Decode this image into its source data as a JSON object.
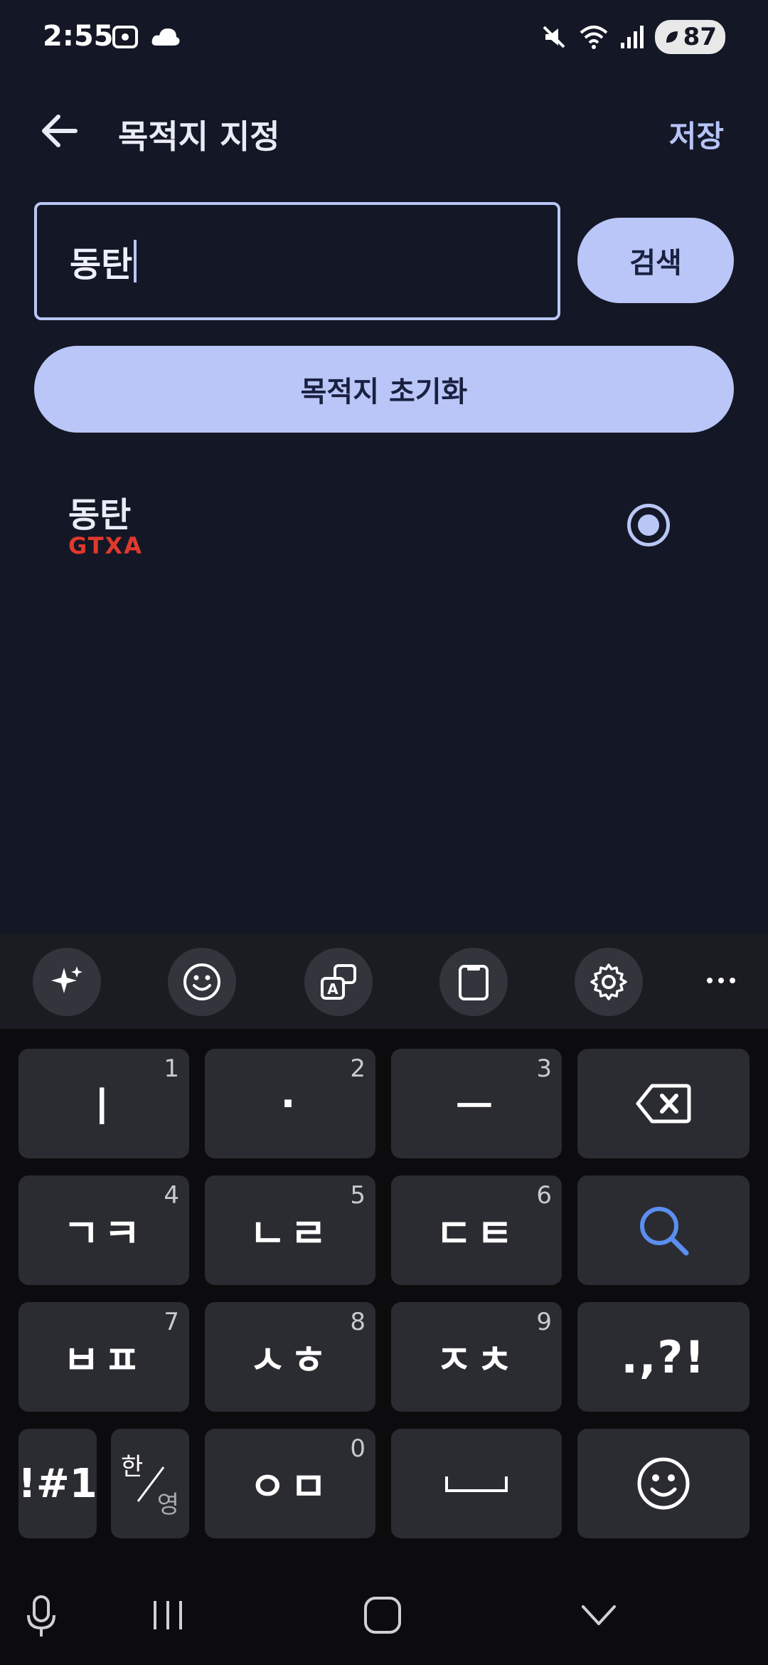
{
  "status": {
    "time": "2:55",
    "battery": "87"
  },
  "header": {
    "title": "목적지 지정",
    "save_label": "저장"
  },
  "search": {
    "value": "동탄",
    "button_label": "검색"
  },
  "reset_label": "목적지 초기화",
  "results": [
    {
      "name": "동탄",
      "line": "GTXA",
      "selected": true
    }
  ],
  "keyboard": {
    "rows": [
      [
        {
          "main": "ㅣ",
          "num": "1"
        },
        {
          "main": "·",
          "num": "2"
        },
        {
          "main": "ㅡ",
          "num": "3"
        },
        {
          "icon": "backspace-icon"
        }
      ],
      [
        {
          "main": "ㄱㅋ",
          "num": "4"
        },
        {
          "main": "ㄴㄹ",
          "num": "5"
        },
        {
          "main": "ㄷㅌ",
          "num": "6"
        },
        {
          "icon": "search-icon"
        }
      ],
      [
        {
          "main": "ㅂㅍ",
          "num": "7"
        },
        {
          "main": "ㅅㅎ",
          "num": "8"
        },
        {
          "main": "ㅈㅊ",
          "num": "9"
        },
        {
          "main": ".,?!"
        }
      ],
      [
        {
          "main": "!#1"
        },
        {
          "main": "한",
          "sub": "영"
        },
        {
          "main": "ㅇㅁ",
          "num": "0"
        },
        {
          "icon": "space-icon"
        },
        {
          "icon": "emoji-icon"
        }
      ]
    ],
    "toolbar_icons": [
      "ai-sparkle-icon",
      "emoji-icon",
      "translate-icon",
      "clipboard-icon",
      "settings-icon",
      "more-icon"
    ]
  },
  "colors": {
    "accent": "#bac6f7",
    "background": "#141725",
    "line_color": "#e0392e"
  }
}
